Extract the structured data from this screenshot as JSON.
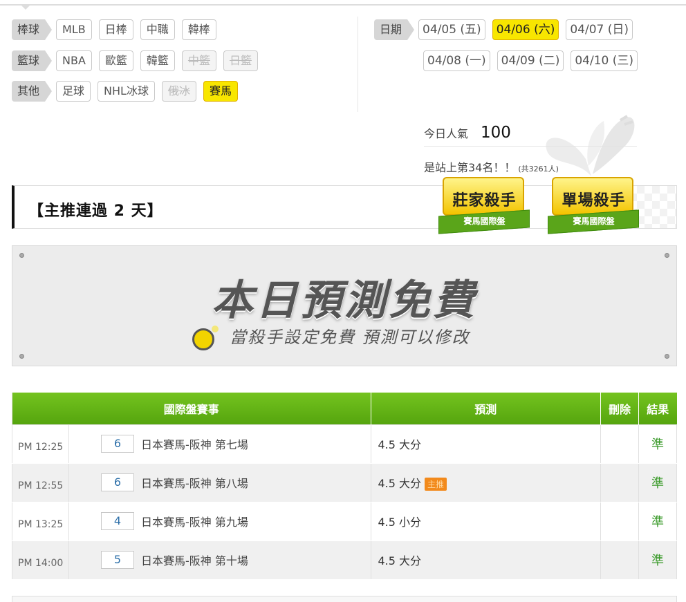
{
  "sports": {
    "rows": [
      {
        "category": "棒球",
        "items": [
          {
            "label": "MLB",
            "state": "normal"
          },
          {
            "label": "日棒",
            "state": "normal"
          },
          {
            "label": "中職",
            "state": "normal"
          },
          {
            "label": "韓棒",
            "state": "normal"
          }
        ]
      },
      {
        "category": "籃球",
        "items": [
          {
            "label": "NBA",
            "state": "normal"
          },
          {
            "label": "歐籃",
            "state": "normal"
          },
          {
            "label": "韓籃",
            "state": "normal"
          },
          {
            "label": "中籃",
            "state": "disabled"
          },
          {
            "label": "日籃",
            "state": "disabled"
          }
        ]
      },
      {
        "category": "其他",
        "items": [
          {
            "label": "足球",
            "state": "normal"
          },
          {
            "label": "NHL冰球",
            "state": "normal"
          },
          {
            "label": "俄冰",
            "state": "disabled"
          },
          {
            "label": "賽馬",
            "state": "selected"
          }
        ]
      }
    ]
  },
  "dates": {
    "label": "日期",
    "row1": [
      {
        "label": "04/05 (五)",
        "selected": false
      },
      {
        "label": "04/06 (六)",
        "selected": true
      },
      {
        "label": "04/07 (日)",
        "selected": false
      }
    ],
    "row2": [
      {
        "label": "04/08 (一)",
        "selected": false
      },
      {
        "label": "04/09 (二)",
        "selected": false
      },
      {
        "label": "04/10 (三)",
        "selected": false
      }
    ]
  },
  "popularity": {
    "label": "今日人氣",
    "value": "100",
    "rank_text": "是站上第34名！！",
    "total_text": "(共3261人)"
  },
  "banner": {
    "title": "【主推連過 2 天】",
    "badges": [
      {
        "title": "莊家殺手",
        "subtitle": "賽馬國際盤"
      },
      {
        "title": "單場殺手",
        "subtitle": "賽馬國際盤"
      }
    ]
  },
  "free_notice": {
    "title": "本日預測免費",
    "subtitle": "當殺手設定免費 預測可以修改"
  },
  "table": {
    "headers": {
      "game": "國際盤賽事",
      "prediction": "預測",
      "delete": "刪除",
      "result": "結果"
    },
    "main_tag": "主推",
    "rows": [
      {
        "time": "PM 12:25",
        "number": "6",
        "name": "日本賽馬-阪神 第七場",
        "prediction": "4.5 大分",
        "main": false,
        "result": "準"
      },
      {
        "time": "PM 12:55",
        "number": "6",
        "name": "日本賽馬-阪神 第八場",
        "prediction": "4.5 大分",
        "main": true,
        "result": "準"
      },
      {
        "time": "PM 13:25",
        "number": "4",
        "name": "日本賽馬-阪神 第九場",
        "prediction": "4.5 小分",
        "main": false,
        "result": "準"
      },
      {
        "time": "PM 14:00",
        "number": "5",
        "name": "日本賽馬-阪神 第十場",
        "prediction": "4.5 大分",
        "main": false,
        "result": "準"
      }
    ]
  },
  "colors": {
    "selected": "#f8e600",
    "header_green": "#5fb014",
    "result_green": "#3a9a2a",
    "main_tag": "#f28a1c"
  }
}
